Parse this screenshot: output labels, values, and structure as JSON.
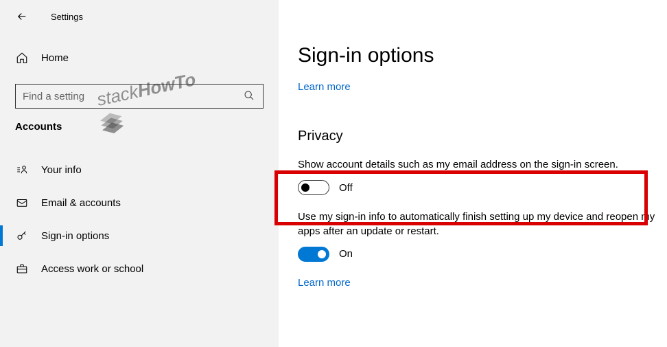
{
  "header": {
    "title": "Settings"
  },
  "sidebar": {
    "home_label": "Home",
    "search_placeholder": "Find a setting",
    "category": "Accounts",
    "items": [
      {
        "label": "Your info"
      },
      {
        "label": "Email & accounts"
      },
      {
        "label": "Sign-in options"
      },
      {
        "label": "Access work or school"
      }
    ]
  },
  "main": {
    "title": "Sign-in options",
    "learn_more": "Learn more",
    "privacy": {
      "heading": "Privacy",
      "setting1": {
        "desc": "Show account details such as my email address on the sign-in screen.",
        "state": "Off"
      },
      "setting2": {
        "desc": "Use my sign-in info to automatically finish setting up my device and reopen my apps after an update or restart.",
        "state": "On"
      },
      "learn_more": "Learn more"
    }
  },
  "watermark": {
    "text1": "stack",
    "text2": "HowTo"
  }
}
